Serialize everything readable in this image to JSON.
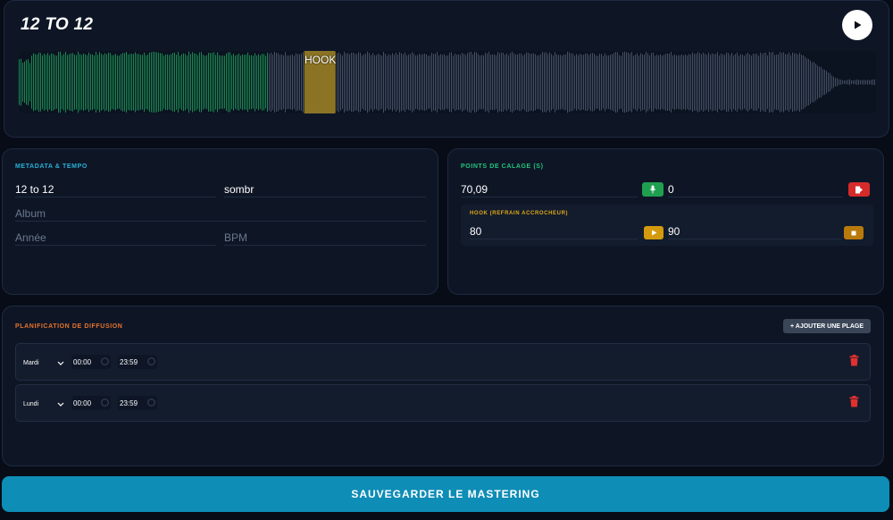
{
  "player": {
    "track_title": "12 TO 12",
    "hook_label": "HOOK",
    "played_fraction": 0.29,
    "hook_start_fraction": 0.333,
    "hook_end_fraction": 0.369,
    "colors": {
      "played": "#1f9e5a",
      "hook": "#b8962a",
      "unplayed": "#5c6b80"
    }
  },
  "metadata": {
    "section_title": "METADATA & TEMPO",
    "title_value": "12 to 12",
    "genre_value": "sombr",
    "album_placeholder": "Album",
    "year_placeholder": "Année",
    "bpm_placeholder": "BPM"
  },
  "calage": {
    "section_title": "POINTS DE CALAGE (S)",
    "start_value": "70,09",
    "end_value": "0",
    "hook_title": "HOOK (REFRAIN ACCROCHEUR)",
    "hook_start_value": "80",
    "hook_end_value": "90",
    "colors": {
      "mic": "#1fa050",
      "exit": "#d62b2b",
      "hook_play": "#d49a0e",
      "hook_stop": "#b97a0c"
    }
  },
  "planning": {
    "section_title": "PLANIFICATION DE DIFFUSION",
    "add_button_label": "+ AJOUTER UNE PLAGE",
    "slots": [
      {
        "day": "Mardi",
        "start": "00:00",
        "end": "23:59"
      },
      {
        "day": "Lundi",
        "start": "00:00",
        "end": "23:59"
      }
    ]
  },
  "save_button_label": "SAUVEGARDER LE MASTERING"
}
